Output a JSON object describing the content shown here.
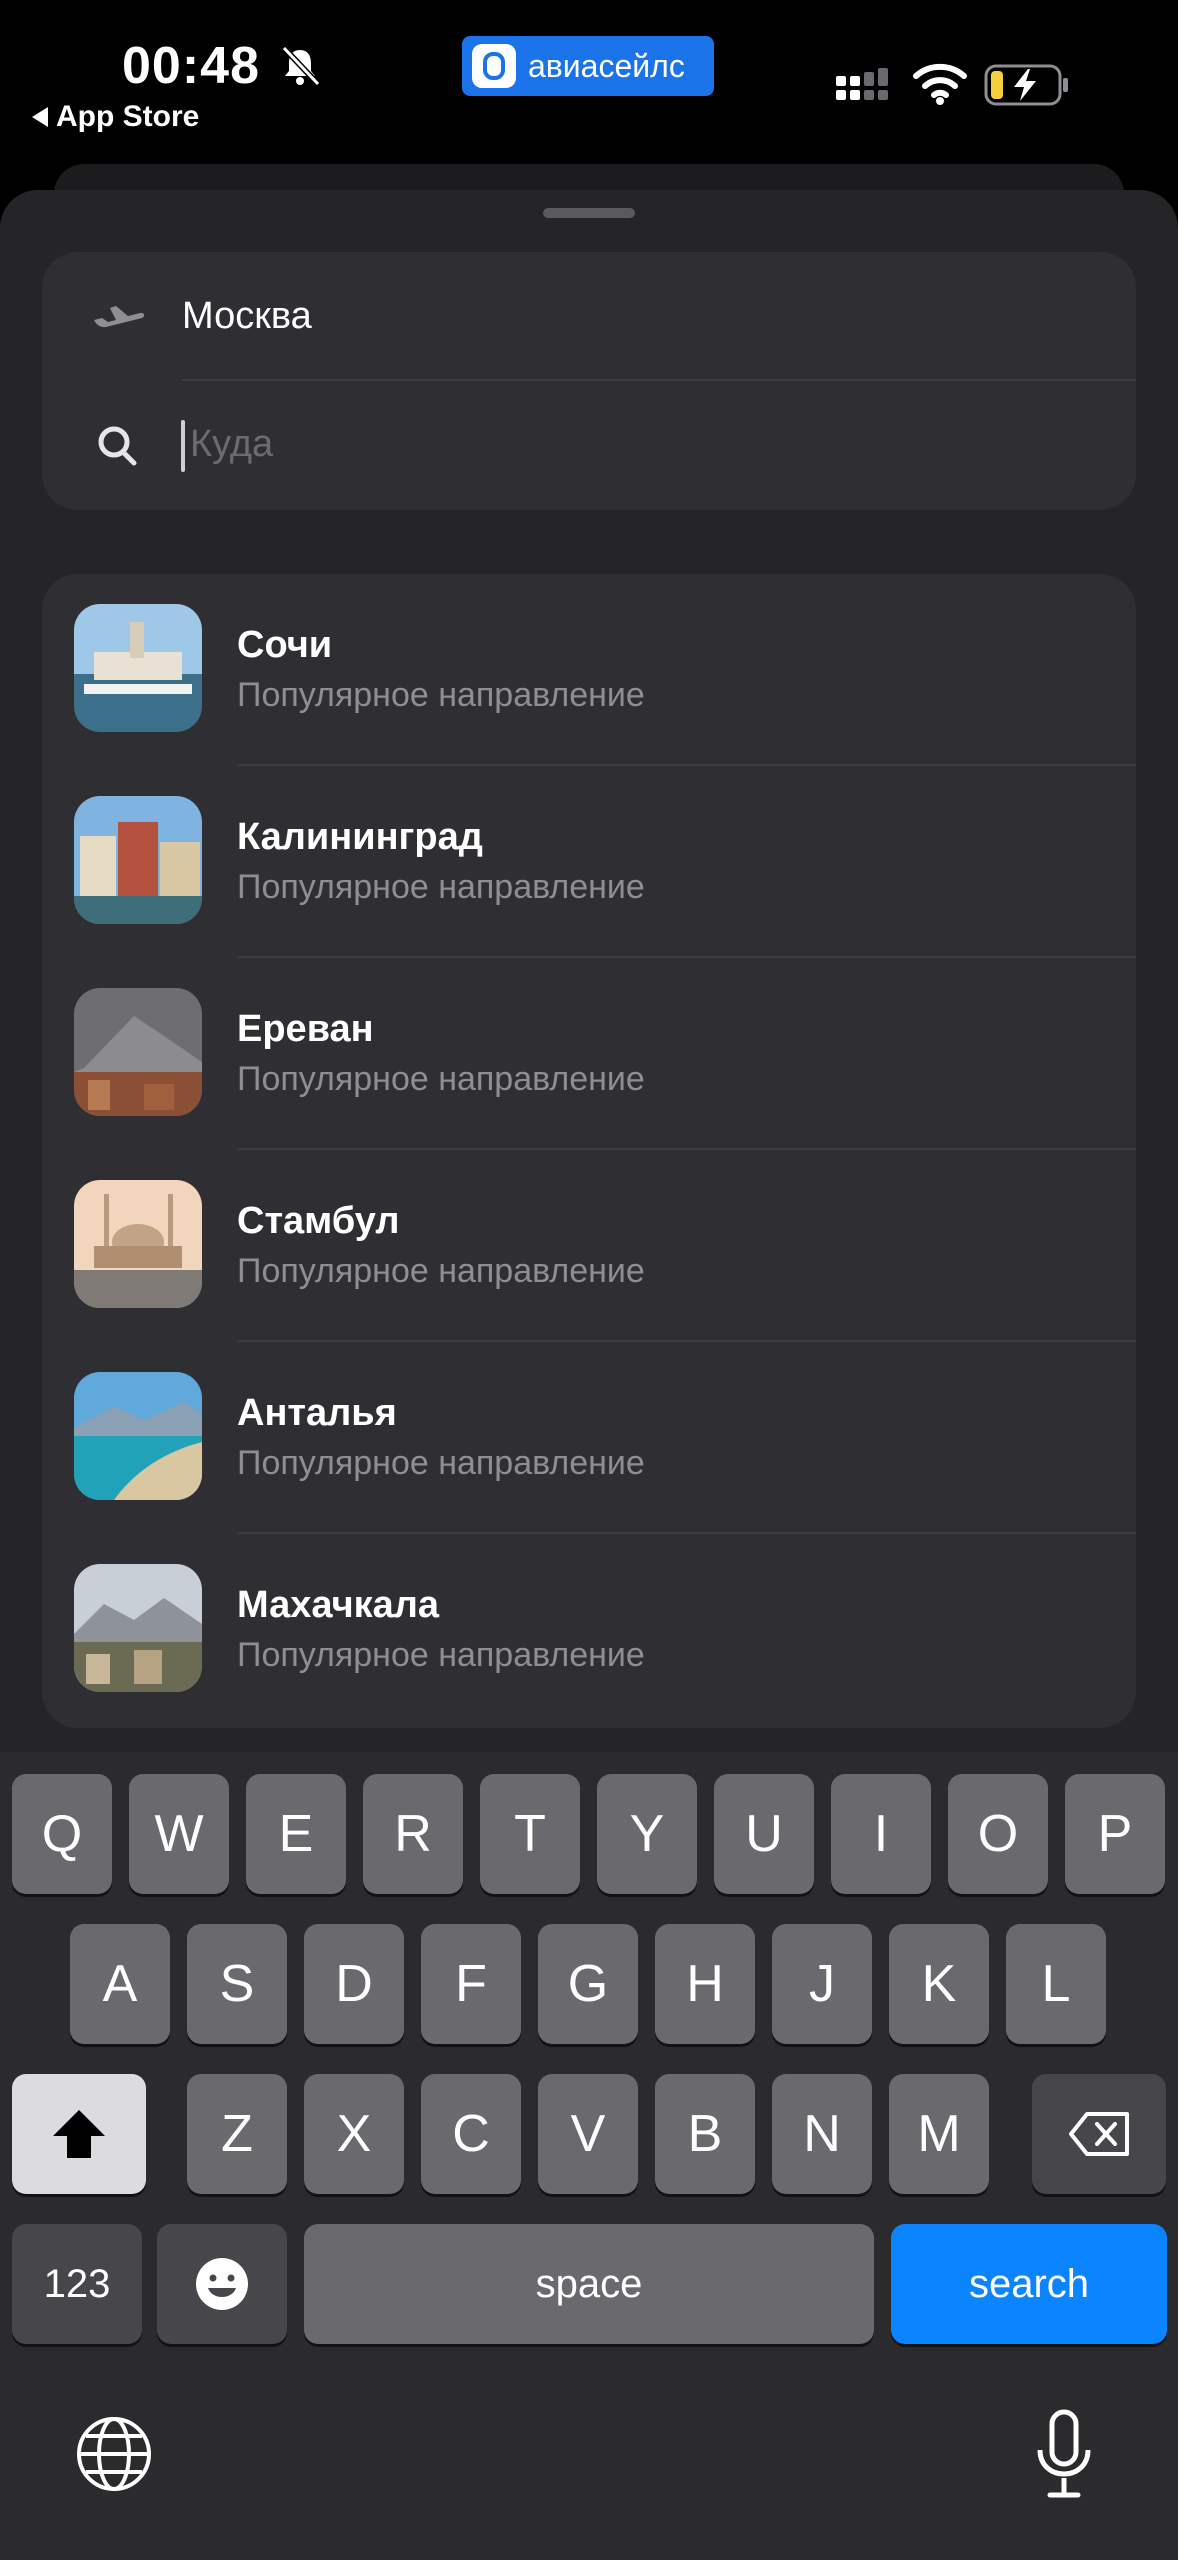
{
  "status_bar": {
    "time": "00:48",
    "back_label": "App Store",
    "app_name": "авиасейлс"
  },
  "search": {
    "origin": "Москва",
    "destination_placeholder": "Куда"
  },
  "destinations": [
    {
      "city": "Сочи",
      "subtitle": "Популярное направление"
    },
    {
      "city": "Калининград",
      "subtitle": "Популярное направление"
    },
    {
      "city": "Ереван",
      "subtitle": "Популярное направление"
    },
    {
      "city": "Стамбул",
      "subtitle": "Популярное направление"
    },
    {
      "city": "Анталья",
      "subtitle": "Популярное направление"
    },
    {
      "city": "Махачкала",
      "subtitle": "Популярное направление"
    }
  ],
  "keyboard": {
    "row1": [
      "Q",
      "W",
      "E",
      "R",
      "T",
      "Y",
      "U",
      "I",
      "O",
      "P"
    ],
    "row2": [
      "A",
      "S",
      "D",
      "F",
      "G",
      "H",
      "J",
      "K",
      "L"
    ],
    "row3": [
      "Z",
      "X",
      "C",
      "V",
      "B",
      "N",
      "M"
    ],
    "numbers_label": "123",
    "space_label": "space",
    "search_label": "search"
  },
  "colors": {
    "accent": "#0a84ff",
    "brand": "#1a73e8"
  }
}
